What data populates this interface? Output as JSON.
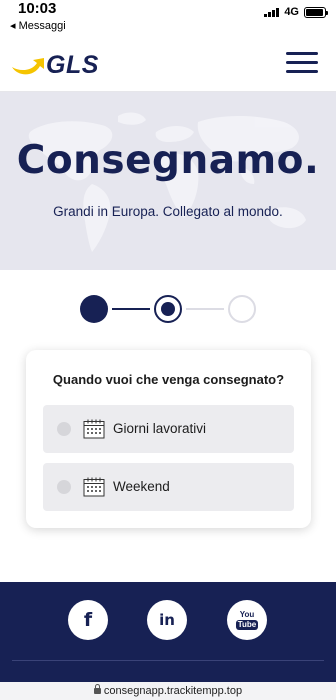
{
  "status_bar": {
    "time": "10:03",
    "back_label": "◂ Messaggi",
    "network": "4G",
    "signal_bars": 4,
    "battery_level": 0.95
  },
  "header": {
    "logo_text": "GLS",
    "logo_arrow_color": "#f5c400",
    "brand_color": "#172154",
    "menu_icon": "hamburger-menu-icon"
  },
  "hero": {
    "title": "Consegnamo.",
    "subtitle": "Grandi in Europa. Collegato al mondo.",
    "background_color": "#e6e6ee"
  },
  "stepper": {
    "total_steps": 3,
    "current_step": 2
  },
  "delivery_card": {
    "question": "Quando vuoi che venga consegnato?",
    "options": [
      {
        "label": "Giorni lavorativi",
        "icon": "calendar-icon",
        "selected": false
      },
      {
        "label": "Weekend",
        "icon": "calendar-icon",
        "selected": false
      }
    ]
  },
  "footer": {
    "background_color": "#172154",
    "social": [
      {
        "name": "facebook",
        "glyph": "f",
        "icon": "facebook-icon"
      },
      {
        "name": "linkedin",
        "glyph": "in",
        "icon": "linkedin-icon"
      },
      {
        "name": "youtube",
        "glyph_top": "You",
        "glyph_bottom": "Tube",
        "icon": "youtube-icon"
      }
    ]
  },
  "url_bar": {
    "url": "consegnapp.trackitempp.top"
  }
}
